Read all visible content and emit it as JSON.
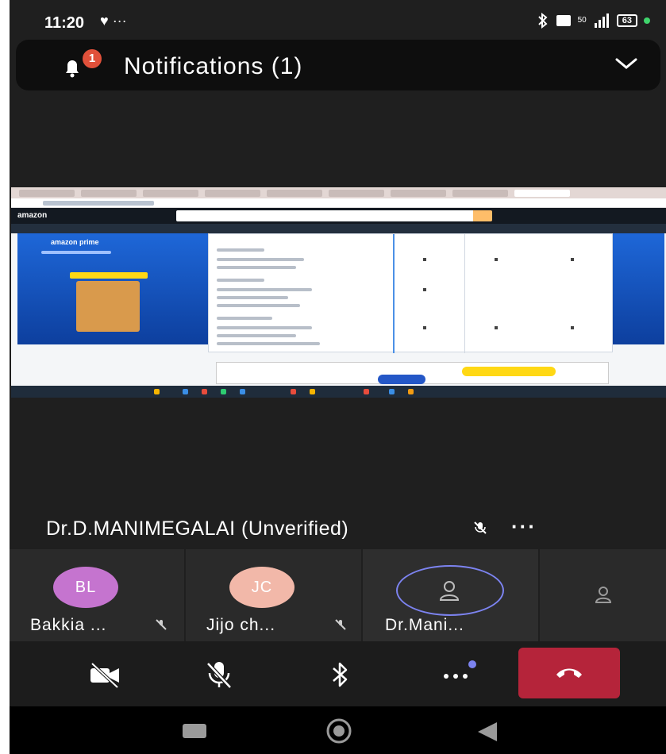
{
  "status_bar": {
    "time": "11:20",
    "left_icons": "♥ ···",
    "net_top": "50",
    "battery": "63"
  },
  "notification": {
    "title": "Notifications (1)",
    "badge": "1"
  },
  "presenter": {
    "name": "Dr.D.MANIMEGALAI (Unverified)",
    "more": "···"
  },
  "participants": [
    {
      "initials": "BL",
      "name": "Bakkia ...",
      "color": "#c574cf"
    },
    {
      "initials": "JC",
      "name": "Jijo ch...",
      "color": "#f2b8a9"
    },
    {
      "initials": "",
      "name": "Dr.Mani...",
      "color": "#7c83f0"
    }
  ],
  "controls": {
    "camera": "camera-off-icon",
    "mic": "mic-off-icon",
    "bluetooth": "bluetooth-icon",
    "more": "more-icon",
    "end_call": "end-call-icon"
  },
  "colors": {
    "end_call": "#b5243a",
    "speaking_ring": "#7c83f0",
    "badge": "#e0503a"
  }
}
